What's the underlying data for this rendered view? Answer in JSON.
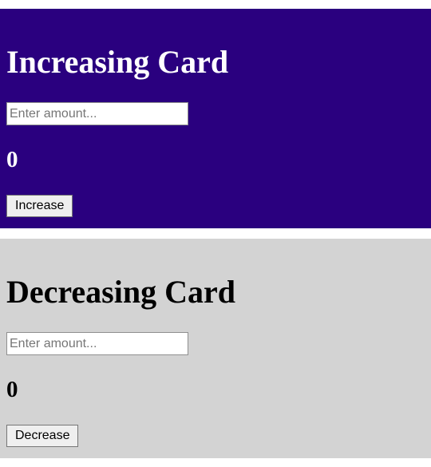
{
  "increasing_card": {
    "title": "Increasing Card",
    "amount_input": {
      "value": "",
      "placeholder": "Enter amount..."
    },
    "count": "0",
    "button_label": "Increase"
  },
  "decreasing_card": {
    "title": "Decreasing Card",
    "amount_input": {
      "value": "",
      "placeholder": "Enter amount..."
    },
    "count": "0",
    "button_label": "Decrease"
  },
  "colors": {
    "increasing_background": "#2a007f",
    "increasing_text": "#ffffff",
    "decreasing_background": "#d3d3d3",
    "decreasing_text": "#000000"
  }
}
